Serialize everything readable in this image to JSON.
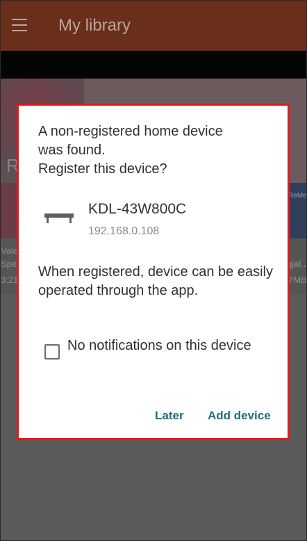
{
  "appbar": {
    "title": "My library"
  },
  "background": {
    "hero_letter": "R",
    "left_title_1": "Vale",
    "left_title_2": "Spe",
    "left_meta": "3:21",
    "right_title_1": "gjal...",
    "right_meta": "7MB",
    "right_thumb_text": "ReMe"
  },
  "dialog": {
    "message": "A non-registered home device\nwas found.\nRegister this device?",
    "device_name": "KDL-43W800C",
    "device_ip": "192.168.0.108",
    "info": "When registered, device can be easily operated through the app.",
    "checkbox_label": "No notifications on this device",
    "checkbox_checked": false,
    "later_label": "Later",
    "add_label": "Add device"
  },
  "colors": {
    "accent_button": "#1f6f7a",
    "dialog_highlight_border": "#e11a1a",
    "appbar": "#6a2f1a"
  },
  "icons": {
    "menu": "hamburger-menu-icon",
    "device": "tv-device-icon"
  }
}
